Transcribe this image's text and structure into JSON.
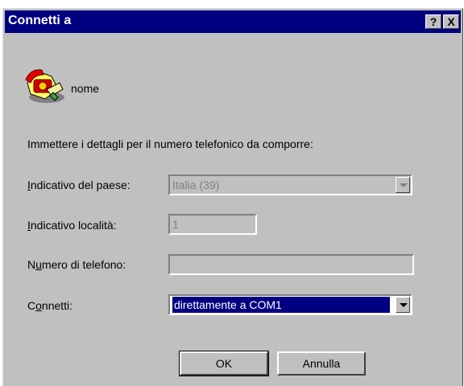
{
  "window": {
    "title": "Connetti a"
  },
  "titlebar_buttons": {
    "help": "?",
    "close": "X"
  },
  "connection": {
    "name": "nome",
    "icon": "phone-connection-icon"
  },
  "form": {
    "instructions": "Immettere i dettagli per il numero telefonico da comporre:",
    "country": {
      "label_first": "I",
      "label_rest": "ndicativo del paese:",
      "value": "Italia (39)"
    },
    "area_code": {
      "label_first": "I",
      "label_rest": "ndicativo località:",
      "value": "1"
    },
    "phone": {
      "label_pre": "N",
      "label_u": "u",
      "label_rest": "mero di telefono:",
      "value": ""
    },
    "connect_via": {
      "label_pre": "C",
      "label_u": "o",
      "label_rest": "nnetti:",
      "value": "direttamente a COM1"
    }
  },
  "buttons": {
    "ok": "OK",
    "cancel": "Annulla"
  },
  "colors": {
    "titlebar": "#000080",
    "face": "#c0c0c0",
    "selection": "#000080"
  }
}
